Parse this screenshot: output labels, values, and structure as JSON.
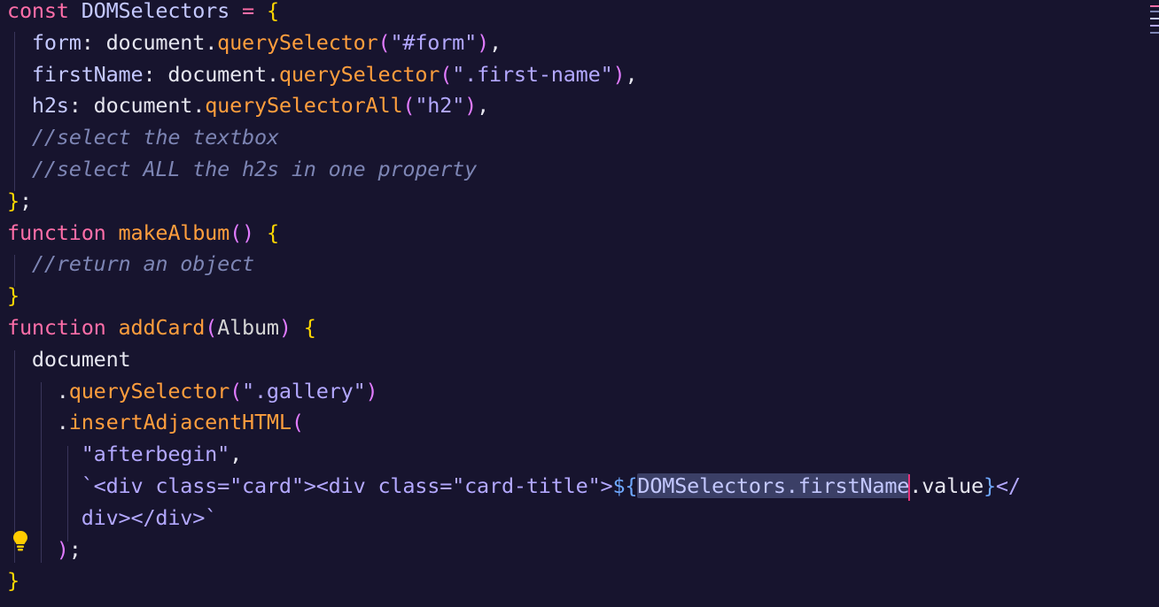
{
  "colors": {
    "background": "#17142e",
    "keyword": "#ff6ea8",
    "identifier": "#c4c8ff",
    "plain": "#e6e6ef",
    "method": "#ff9e3d",
    "string": "#b3a8ff",
    "comment": "#7d85b4",
    "brace": "#ffd700",
    "paren": "#e07bff",
    "interp": "#6fa8ff",
    "param": "#d5d5d5",
    "punct": "#e6e6ef"
  },
  "code_lines": [
    [
      [
        "keyword",
        "const "
      ],
      [
        "identifier",
        "DOMSelectors "
      ],
      [
        "keyword",
        "= "
      ],
      [
        "brace",
        "{"
      ]
    ],
    [
      [
        "plain",
        "  "
      ],
      [
        "identifier",
        "form"
      ],
      [
        "punct",
        ": "
      ],
      [
        "plain",
        "document"
      ],
      [
        "punct",
        "."
      ],
      [
        "method",
        "querySelector"
      ],
      [
        "paren",
        "("
      ],
      [
        "string",
        "\"#form\""
      ],
      [
        "paren",
        ")"
      ],
      [
        "punct",
        ","
      ]
    ],
    [
      [
        "plain",
        "  "
      ],
      [
        "identifier",
        "firstName"
      ],
      [
        "punct",
        ": "
      ],
      [
        "plain",
        "document"
      ],
      [
        "punct",
        "."
      ],
      [
        "method",
        "querySelector"
      ],
      [
        "paren",
        "("
      ],
      [
        "string",
        "\".first-name\""
      ],
      [
        "paren",
        ")"
      ],
      [
        "punct",
        ","
      ]
    ],
    [
      [
        "plain",
        "  "
      ],
      [
        "identifier",
        "h2s"
      ],
      [
        "punct",
        ": "
      ],
      [
        "plain",
        "document"
      ],
      [
        "punct",
        "."
      ],
      [
        "method",
        "querySelectorAll"
      ],
      [
        "paren",
        "("
      ],
      [
        "string",
        "\"h2\""
      ],
      [
        "paren",
        ")"
      ],
      [
        "punct",
        ","
      ]
    ],
    [
      [
        "plain",
        "  "
      ],
      [
        "comment",
        "//select the textbox"
      ]
    ],
    [
      [
        "plain",
        "  "
      ],
      [
        "comment",
        "//select ALL the h2s in one property"
      ]
    ],
    [
      [
        "brace",
        "}"
      ],
      [
        "punct",
        ";"
      ]
    ],
    [
      [
        "keyword",
        "function "
      ],
      [
        "method",
        "makeAlbum"
      ],
      [
        "paren",
        "() "
      ],
      [
        "brace",
        "{"
      ]
    ],
    [
      [
        "plain",
        "  "
      ],
      [
        "comment",
        "//return an object"
      ]
    ],
    [
      [
        "brace",
        "}"
      ]
    ],
    [
      [
        "keyword",
        "function "
      ],
      [
        "method",
        "addCard"
      ],
      [
        "paren",
        "("
      ],
      [
        "param",
        "Album"
      ],
      [
        "paren",
        ") "
      ],
      [
        "brace",
        "{"
      ]
    ],
    [
      [
        "plain",
        "  "
      ],
      [
        "plain",
        "document"
      ]
    ],
    [
      [
        "plain",
        "    "
      ],
      [
        "punct",
        "."
      ],
      [
        "method",
        "querySelector"
      ],
      [
        "paren",
        "("
      ],
      [
        "string",
        "\".gallery\""
      ],
      [
        "paren",
        ")"
      ]
    ],
    [
      [
        "plain",
        "    "
      ],
      [
        "punct",
        "."
      ],
      [
        "method",
        "insertAdjacentHTML"
      ],
      [
        "paren",
        "("
      ]
    ],
    [
      [
        "plain",
        "      "
      ],
      [
        "string",
        "\"afterbegin\""
      ],
      [
        "punct",
        ","
      ]
    ],
    [
      [
        "plain",
        "      "
      ],
      [
        "string",
        "`<div class=\"card\"><div class=\"card-title\">"
      ],
      [
        "interp",
        "${"
      ],
      [
        "sel",
        "DOMSelectors.firstName"
      ],
      [
        "caret",
        ""
      ],
      [
        "plain",
        ".value"
      ],
      [
        "interp",
        "}"
      ],
      [
        "string",
        "</"
      ]
    ],
    [
      [
        "plain",
        "      "
      ],
      [
        "string",
        "div></div>`"
      ]
    ],
    [
      [
        "plain",
        "    "
      ],
      [
        "paren",
        ")"
      ],
      [
        "punct",
        ";"
      ]
    ],
    [
      [
        "brace",
        "}"
      ]
    ]
  ]
}
